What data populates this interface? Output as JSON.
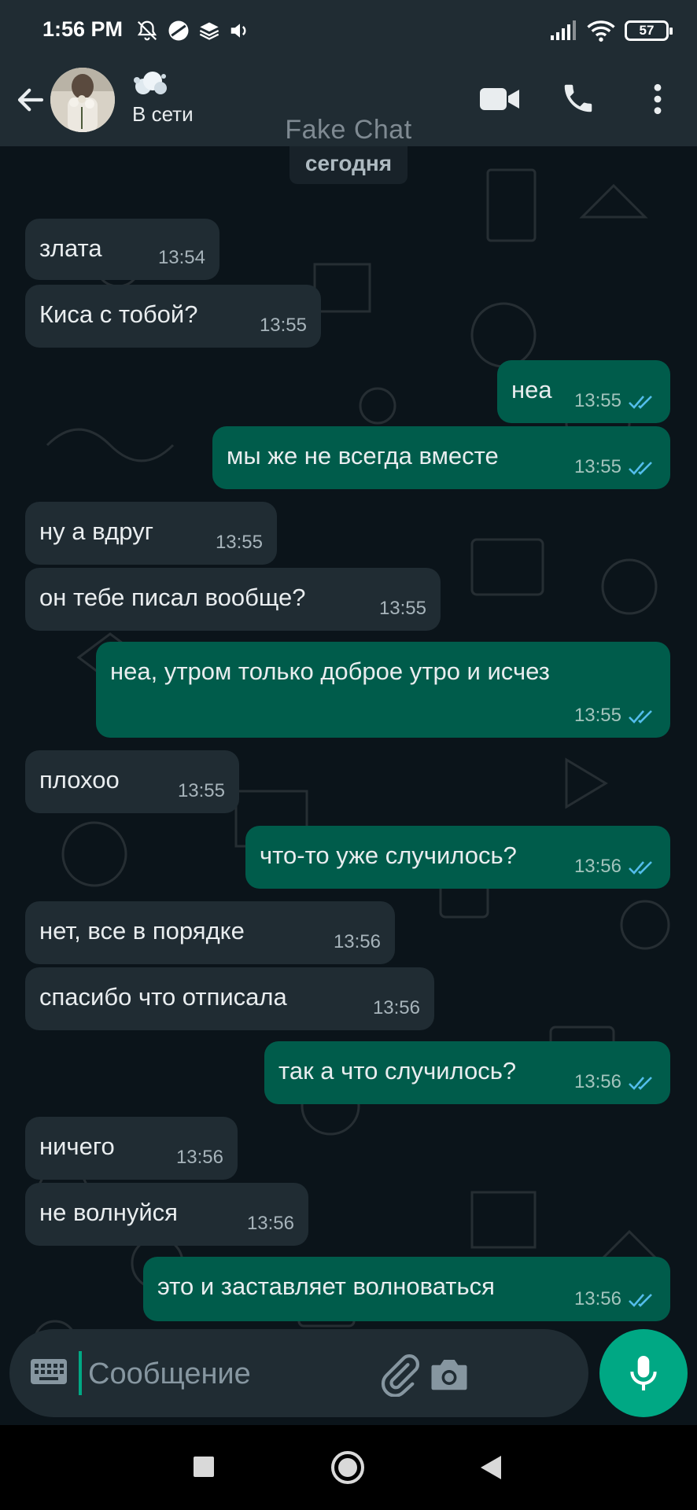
{
  "status_bar": {
    "time": "1:56 PM",
    "left_icons": [
      "bell-off-icon",
      "no-disturb-icon",
      "layers-icon",
      "volume-icon"
    ],
    "right_icons": [
      "signal-icon",
      "wifi-icon",
      "battery-icon"
    ],
    "battery_level": "57"
  },
  "header": {
    "contact_status": "В сети",
    "watermark": "Fake Chat",
    "icons": [
      "back-arrow-icon",
      "video-call-icon",
      "phone-icon",
      "more-vertical-icon"
    ]
  },
  "chat": {
    "date_label": "сегодня",
    "messages": [
      {
        "dir": "in",
        "text": "злата",
        "time": "13:54"
      },
      {
        "dir": "in",
        "text": "Киса с тобой?",
        "time": "13:55"
      },
      {
        "dir": "out",
        "text": "неа",
        "time": "13:55",
        "read": true
      },
      {
        "dir": "out",
        "text": "мы же не всегда вместе",
        "time": "13:55",
        "read": true
      },
      {
        "dir": "in",
        "text": "ну а вдруг",
        "time": "13:55"
      },
      {
        "dir": "in",
        "text": "он тебе писал вообще?",
        "time": "13:55"
      },
      {
        "dir": "out",
        "text": "неа, утром только доброе утро и исчез",
        "time": "13:55",
        "read": true
      },
      {
        "dir": "in",
        "text": "плохоо",
        "time": "13:55"
      },
      {
        "dir": "out",
        "text": "что-то уже случилось?",
        "time": "13:56",
        "read": true
      },
      {
        "dir": "in",
        "text": "нет, все в порядке",
        "time": "13:56"
      },
      {
        "dir": "in",
        "text": "спасибо что отписала",
        "time": "13:56"
      },
      {
        "dir": "out",
        "text": "так а что случилось?",
        "time": "13:56",
        "read": true
      },
      {
        "dir": "in",
        "text": "ничего",
        "time": "13:56"
      },
      {
        "dir": "in",
        "text": "не волнуйся",
        "time": "13:56"
      },
      {
        "dir": "out",
        "text": "это и заставляет волноваться",
        "time": "13:56",
        "read": true
      }
    ]
  },
  "input": {
    "placeholder": "Сообщение",
    "icons": [
      "keyboard-icon",
      "attach-icon",
      "camera-icon",
      "mic-icon"
    ]
  },
  "colors": {
    "header_bg": "#202c33",
    "chat_bg": "#0b141a",
    "incoming_bubble": "#202c33",
    "outgoing_bubble": "#005c4b",
    "accent": "#00a884",
    "read_tick": "#53bdeb"
  },
  "nav_bar": {
    "icons": [
      "recents-square-icon",
      "home-circle-icon",
      "back-triangle-icon"
    ]
  }
}
